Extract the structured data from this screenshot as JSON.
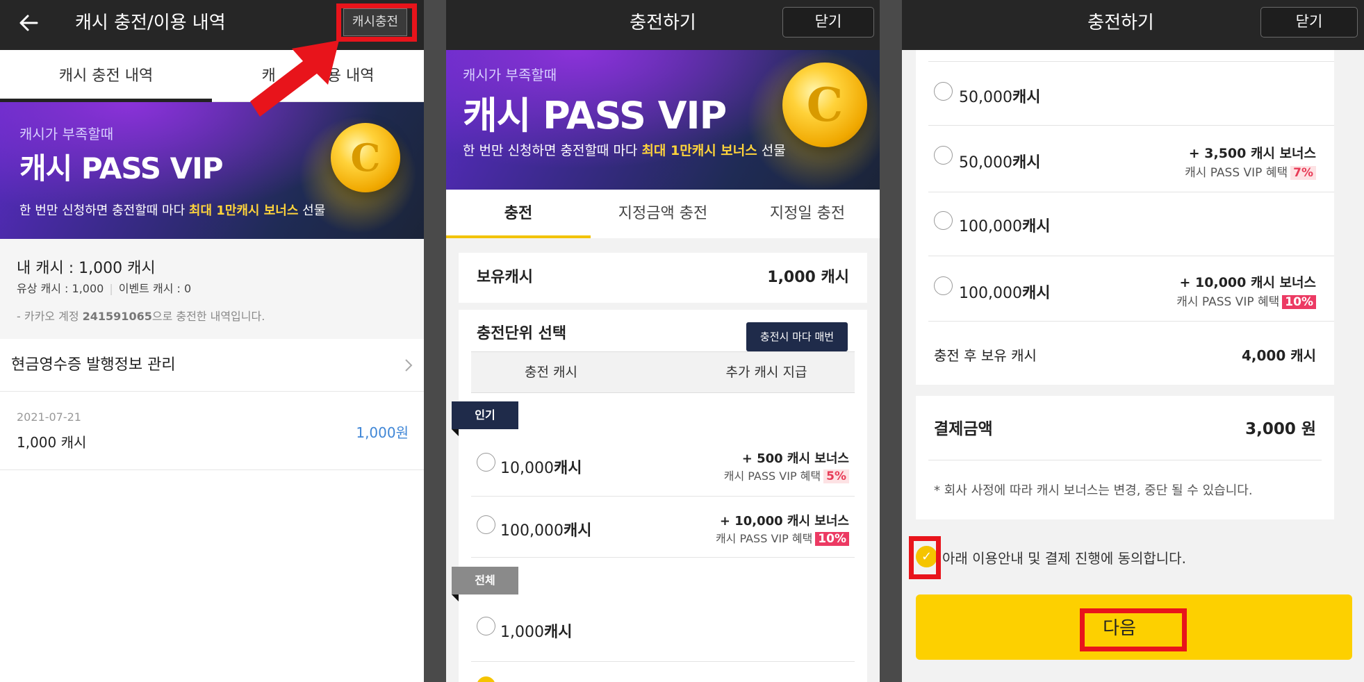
{
  "colors": {
    "accent_yellow": "#fdd000",
    "emphasis_red": "#e8141b",
    "header_dark": "#262626",
    "price_blue": "#3f86d6",
    "bonus_pink": "#ec3a63"
  },
  "panel1": {
    "back_icon": "back-arrow-icon",
    "title": "캐시 충전/이용 내역",
    "charge_button": "캐시충전",
    "tabs": [
      "캐시 충전 내역",
      "캐시 이용 내역"
    ],
    "tab2_visible": "캐",
    "tab2_visible_end": "용 내역",
    "banner": {
      "top": "캐시가 부족할때",
      "big": "캐시 PASS VIP",
      "sub_before": "한 번만 신청하면 충전할때 마다 ",
      "sub_highlight": "최대 1만캐시 보너스",
      "sub_after": " 선물"
    },
    "my_cash": "내 캐시 : 1,000 캐시",
    "paid_cash": "유상 캐시 : 1,000",
    "event_cash": "이벤트 캐시 : 0",
    "account_note_before": "- 카카오 계정 ",
    "account_id": "241591065",
    "account_note_after": "으로 충전한 내역입니다.",
    "receipt_link": "현금영수증 발행정보 관리",
    "history": {
      "date": "2021-07-21",
      "item": "1,000 캐시",
      "price": "1,000원"
    }
  },
  "panel2": {
    "title": "충전하기",
    "close": "닫기",
    "banner": {
      "top": "캐시가 부족할때",
      "big": "캐시 PASS VIP",
      "sub_before": "한 번만 신청하면 충전할때 마다 ",
      "sub_highlight": "최대 1만캐시 보너스",
      "sub_after": " 선물"
    },
    "tabs": [
      "충전",
      "지정금액 충전",
      "지정일 충전"
    ],
    "balance_label": "보유캐시",
    "balance_value": "1,000 캐시",
    "unit_title": "충전단위 선택",
    "tooltip": "충전시 마다 매번",
    "col_charge": "충전 캐시",
    "col_extra": "추가 캐시 지급",
    "flag_popular": "인기",
    "flag_all": "전체",
    "options": [
      {
        "num": "10,000",
        "unit": "캐시",
        "bonus": "+ 500 캐시 보너스",
        "vip": "캐시 PASS VIP 혜택",
        "pct": "5%"
      },
      {
        "num": "100,000",
        "unit": "캐시",
        "bonus": "+ 10,000 캐시 보너스",
        "vip": "캐시 PASS VIP 혜택",
        "pct": "10%"
      },
      {
        "num": "1,000",
        "unit": "캐시"
      }
    ]
  },
  "panel3": {
    "title": "충전하기",
    "close": "닫기",
    "options": [
      {
        "num": "50,000",
        "unit": "캐시"
      },
      {
        "num": "50,000",
        "unit": "캐시",
        "bonus": "+ 3,500 캐시 보너스",
        "vip": "캐시 PASS VIP 혜택",
        "pct": "7%"
      },
      {
        "num": "100,000",
        "unit": "캐시"
      },
      {
        "num": "100,000",
        "unit": "캐시",
        "bonus": "+ 10,000 캐시 보너스",
        "vip": "캐시 PASS VIP 혜택",
        "pct": "10%"
      }
    ],
    "after_label": "충전 후 보유 캐시",
    "after_value": "4,000 캐시",
    "pay_label": "결제금액",
    "pay_value": "3,000 원",
    "notice": "* 회사 사정에 따라 캐시 보너스는 변경, 중단 될 수 있습니다.",
    "agree": "아래 이용안내 및 결제 진행에 동의합니다.",
    "next": "다음"
  }
}
